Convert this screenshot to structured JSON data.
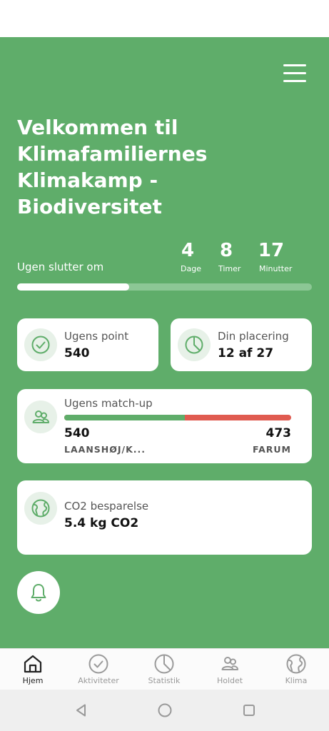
{
  "header": {
    "welcome_text": "Velkommen til Klimafamiliernes Klimakamp - Biodiversitet"
  },
  "countdown": {
    "label": "Ugen slutter om",
    "days": "4",
    "days_unit": "Dage",
    "hours": "8",
    "hours_unit": "Timer",
    "minutes": "17",
    "minutes_unit": "Minutter",
    "week_progress": 0.38
  },
  "cards": {
    "points": {
      "title": "Ugens point",
      "value": "540",
      "icon": "check-circle-icon"
    },
    "placement": {
      "title": "Din placering",
      "value": "12 af 27",
      "icon": "pie-chart-icon"
    },
    "matchup": {
      "title": "Ugens match-up",
      "icon": "team-icon",
      "home_score": "540",
      "home_team": "LAANSHØJ/K...",
      "away_score": "473",
      "away_team": "FARUM",
      "home_share": 0.533
    },
    "co2": {
      "title": "CO2 besparelse",
      "value": "5.4 kg CO2",
      "icon": "globe-icon"
    }
  },
  "tabs": [
    {
      "label": "Hjem",
      "icon": "home-icon",
      "active": true
    },
    {
      "label": "Aktiviteter",
      "icon": "check-circle-icon",
      "active": false
    },
    {
      "label": "Statistik",
      "icon": "pie-chart-icon",
      "active": false
    },
    {
      "label": "Holdet",
      "icon": "team-icon",
      "active": false
    },
    {
      "label": "Klima",
      "icon": "globe-icon",
      "active": false
    }
  ],
  "colors": {
    "brand_green": "#5fad6a",
    "opponent_red": "#e05b50",
    "icon_bg": "#e7f1e8"
  }
}
